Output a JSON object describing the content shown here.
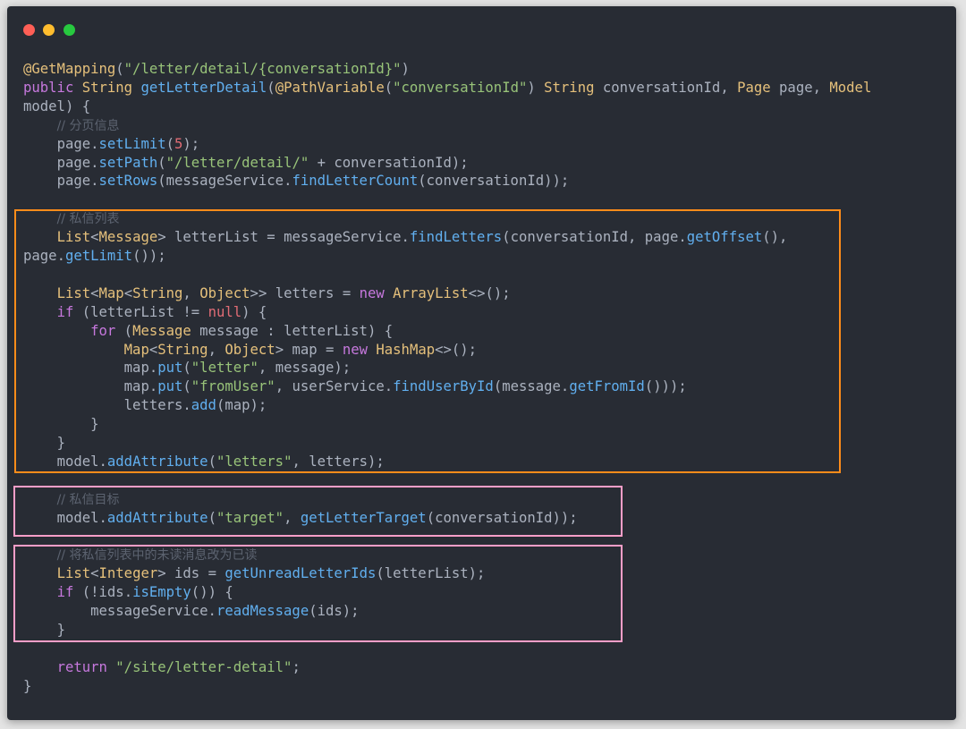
{
  "window": {
    "controls": [
      "close",
      "minimize",
      "maximize"
    ],
    "colors": {
      "close": "#ff5f56",
      "minimize": "#ffbd2e",
      "maximize": "#27c93f",
      "background": "#282c34"
    }
  },
  "highlight_colors": {
    "orange": "#ff8c1a",
    "pink": "#ff9ec8"
  },
  "code": {
    "lines": [
      "@GetMapping(\"/letter/detail/{conversationId}\")",
      "public String getLetterDetail(@PathVariable(\"conversationId\") String conversationId, Page page, Model",
      "model) {",
      "    // 分页信息",
      "    page.setLimit(5);",
      "    page.setPath(\"/letter/detail/\" + conversationId);",
      "    page.setRows(messageService.findLetterCount(conversationId));",
      "",
      "    // 私信列表",
      "    List<Message> letterList = messageService.findLetters(conversationId, page.getOffset(),",
      "page.getLimit());",
      "",
      "    List<Map<String, Object>> letters = new ArrayList<>();",
      "    if (letterList != null) {",
      "        for (Message message : letterList) {",
      "            Map<String, Object> map = new HashMap<>();",
      "            map.put(\"letter\", message);",
      "            map.put(\"fromUser\", userService.findUserById(message.getFromId()));",
      "            letters.add(map);",
      "        }",
      "    }",
      "    model.addAttribute(\"letters\", letters);",
      "",
      "    // 私信目标",
      "    model.addAttribute(\"target\", getLetterTarget(conversationId));",
      "",
      "    // 将私信列表中的未读消息改为已读",
      "    List<Integer> ids = getUnreadLetterIds(letterList);",
      "    if (!ids.isEmpty()) {",
      "        messageService.readMessage(ids);",
      "    }",
      "",
      "    return \"/site/letter-detail\";",
      "}"
    ]
  }
}
